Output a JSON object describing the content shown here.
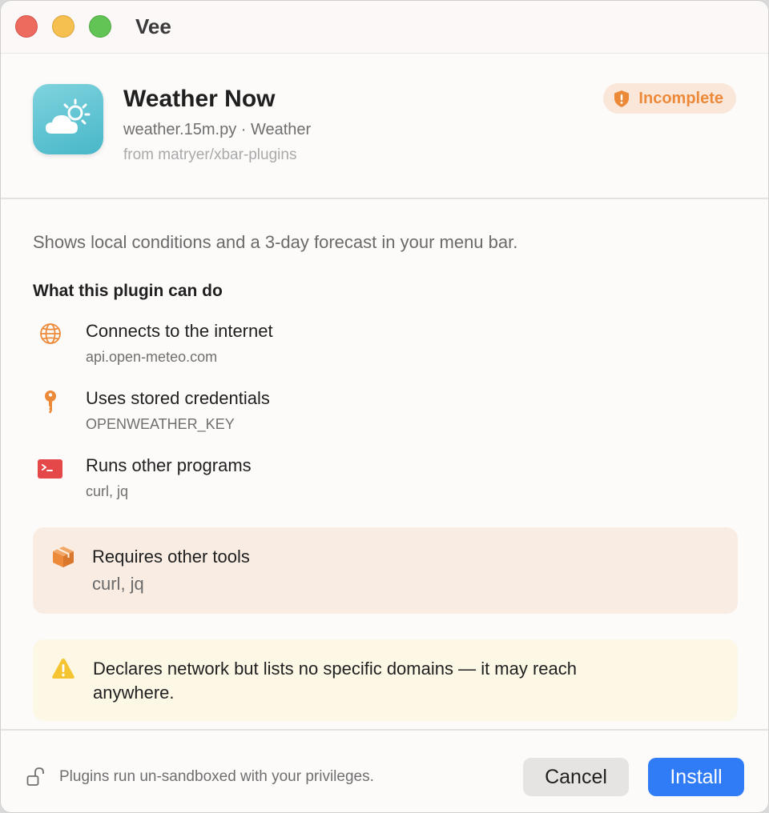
{
  "window": {
    "title": "Vee"
  },
  "plugin": {
    "name": "Weather Now",
    "meta": "weather.15m.py · Weather",
    "source": "from matryer/xbar-plugins",
    "icon": "cloud-sun-icon",
    "status_badge": {
      "label": "Incomplete",
      "icon": "shield-exclamation-icon",
      "color": "#ec8a3a"
    },
    "description": "Shows local conditions and a 3-day forecast in your menu bar."
  },
  "capabilities": {
    "heading": "What this plugin can do",
    "items": [
      {
        "icon": "globe-icon",
        "title": "Connects to the internet",
        "detail": "api.open-meteo.com"
      },
      {
        "icon": "key-icon",
        "title": "Uses stored credentials",
        "detail": "OPENWEATHER_KEY"
      },
      {
        "icon": "terminal-icon",
        "title": "Runs other programs",
        "detail": "curl, jq"
      }
    ]
  },
  "requires": {
    "icon": "package-icon",
    "title": "Requires other tools",
    "detail": "curl, jq"
  },
  "warning": {
    "icon": "warning-triangle-icon",
    "text": "Declares network but lists no specific domains — it may reach anywhere."
  },
  "footer": {
    "note": "Plugins run un-sandboxed with your privileges.",
    "note_icon": "unlock-icon",
    "cancel_label": "Cancel",
    "install_label": "Install"
  },
  "colors": {
    "accent": "#2f7cf6",
    "warning_orange": "#ec8a3a",
    "terminal_red": "#e44848"
  }
}
